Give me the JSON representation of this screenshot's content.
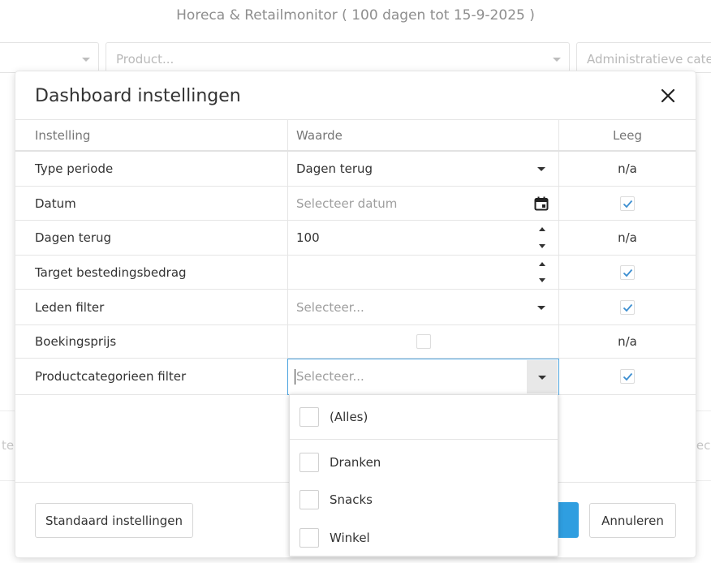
{
  "background": {
    "title": "Horeca & Retailmonitor ( 100 dagen tot 15-9-2025 )",
    "product_placeholder": "Product...",
    "admin_category_placeholder": "Administratieve catego",
    "left_fragment": "te",
    "right_fragment": "tec"
  },
  "modal": {
    "title": "Dashboard instellingen",
    "columns": {
      "setting": "Instelling",
      "value": "Waarde",
      "empty": "Leeg"
    },
    "rows": [
      {
        "label": "Type periode",
        "value": "Dagen terug",
        "empty_text": "n/a"
      },
      {
        "label": "Datum",
        "placeholder": "Selecteer datum",
        "empty_checked": true
      },
      {
        "label": "Dagen terug",
        "value": "100",
        "empty_text": "n/a"
      },
      {
        "label": "Target bestedingsbedrag",
        "value": "",
        "empty_checked": true
      },
      {
        "label": "Leden filter",
        "placeholder": "Selecteer...",
        "empty_checked": true
      },
      {
        "label": "Boekingsprijs",
        "value_checked": false,
        "empty_text": "n/a"
      },
      {
        "label": "Productcategorieen filter",
        "placeholder": "Selecteer...",
        "empty_checked": true
      }
    ],
    "buttons": {
      "defaults": "Standaard instellingen",
      "cancel": "Annuleren"
    }
  },
  "dropdown": {
    "options": [
      {
        "label": "(Alles)",
        "checked": false
      },
      {
        "label": "Dranken",
        "checked": false
      },
      {
        "label": "Snacks",
        "checked": false
      },
      {
        "label": "Winkel",
        "checked": false
      }
    ]
  },
  "colors": {
    "accent": "#2f9ee0",
    "focus_border": "#4aa3df",
    "check": "#3d8fd1"
  }
}
